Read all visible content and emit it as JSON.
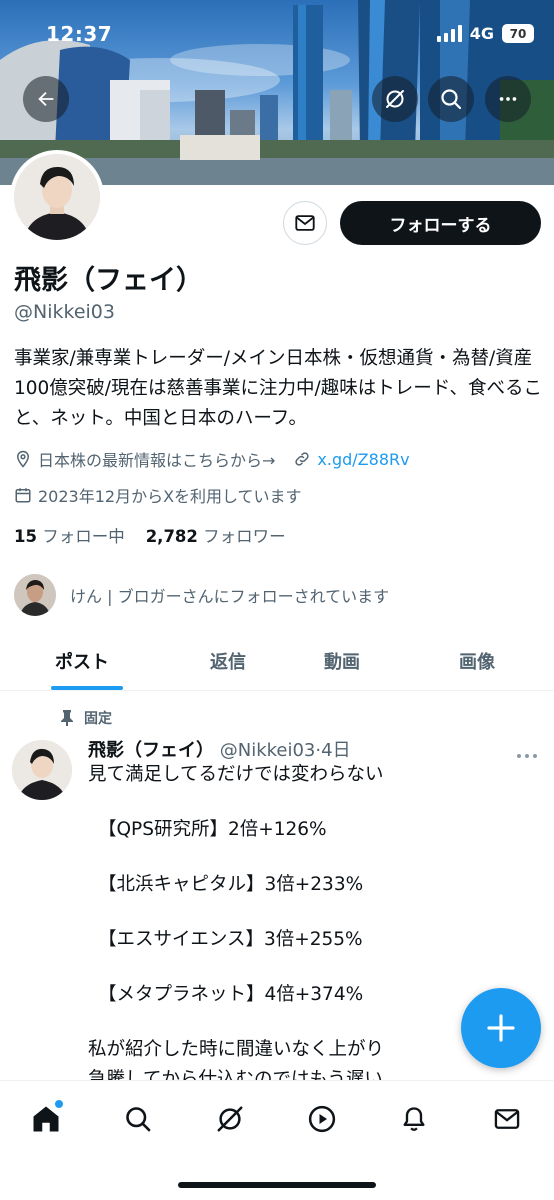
{
  "status_bar": {
    "time": "12:37",
    "network": "4G",
    "battery": "70"
  },
  "header_icons": [
    "back-arrow-icon",
    "grok-icon",
    "search-icon",
    "more-icon"
  ],
  "profile": {
    "name": "飛影（フェイ）",
    "handle": "@Nikkei03",
    "bio": "事業家/兼専業トレーダー/メイン日本株・仮想通貨・為替/資産100億突破/現在は慈善事業に注力中/趣味はトレード、食べること、ネット。中国と日本のハーフ。",
    "location": "日本株の最新情報はこちらから→",
    "website": "x.gd/Z88Rv",
    "joined": "2023年12月からXを利用しています",
    "following_count": "15",
    "following_label": "フォロー中",
    "followers_count": "2,782",
    "followers_label": "フォロワー",
    "followed_by": "けん | ブロガーさんにフォローされています",
    "follow_button": "フォローする"
  },
  "tabs": [
    {
      "label": "ポスト",
      "active": true
    },
    {
      "label": "返信",
      "active": false
    },
    {
      "label": "動画",
      "active": false
    },
    {
      "label": "画像",
      "active": false
    }
  ],
  "pinned_post": {
    "pinned_label": "固定",
    "author_name": "飛影（フェイ）",
    "author_handle": "@Nikkei03",
    "separator": "·",
    "time": "4日",
    "lines": [
      "見て満足してるだけでは変わらない",
      "【QPS研究所】2倍+126%",
      "【北浜キャピタル】3倍+233%",
      "【エスサイエンス】3倍+255%",
      "【メタプラネット】4倍+374%",
      "私が紹介した時に間違いなく上がり",
      "急騰してから仕込むのではもう遅い"
    ]
  },
  "colors": {
    "accent": "#1d9bf0",
    "text": "#0f1419",
    "muted": "#536471"
  },
  "bottom_nav": [
    "home-icon",
    "search-icon",
    "grok-icon",
    "video-icon",
    "notifications-icon",
    "messages-icon"
  ]
}
